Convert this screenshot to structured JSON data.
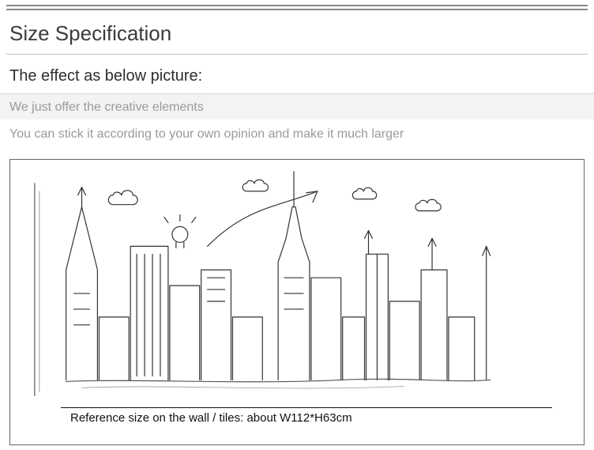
{
  "heading": "Size Specification",
  "subtitle": "The effect as below picture:",
  "info_line1": "We just offer the creative elements",
  "info_line2": "You can stick it according to your own opinion and make it much larger",
  "reference_label": "Reference size on the wall / tiles: about W112*H63cm"
}
